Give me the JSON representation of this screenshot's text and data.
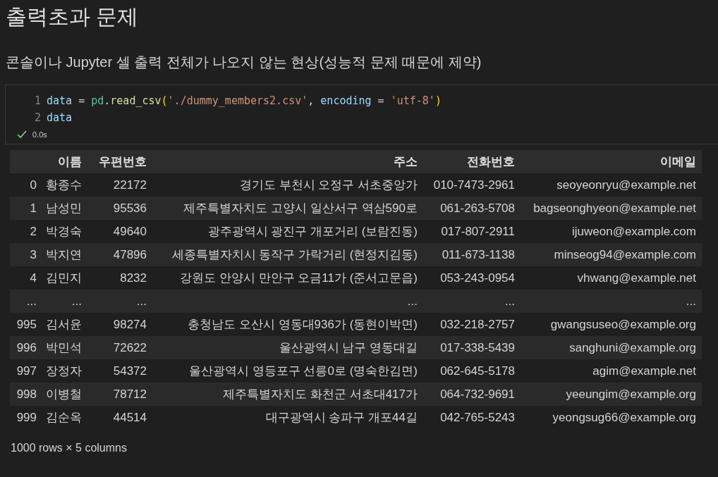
{
  "heading": "출력초과 문제",
  "description": "콘솔이나 Jupyter 셀 출력 전체가 나오지 않는 현상(성능적 문제 때문에 제약)",
  "code_cell": {
    "lines": [
      {
        "number": "1",
        "tokens": [
          {
            "kind": "variable",
            "text": "data"
          },
          {
            "kind": "plain",
            "text": " = "
          },
          {
            "kind": "module",
            "text": "pd"
          },
          {
            "kind": "plain",
            "text": "."
          },
          {
            "kind": "function",
            "text": "read_csv"
          },
          {
            "kind": "bracket",
            "text": "("
          },
          {
            "kind": "string",
            "text": "'./dummy_members2.csv'"
          },
          {
            "kind": "plain",
            "text": ", "
          },
          {
            "kind": "variable",
            "text": "encoding"
          },
          {
            "kind": "plain",
            "text": " = "
          },
          {
            "kind": "string",
            "text": "'utf-8'"
          },
          {
            "kind": "bracket",
            "text": ")"
          }
        ]
      },
      {
        "number": "2",
        "tokens": [
          {
            "kind": "variable",
            "text": "data"
          }
        ]
      }
    ],
    "succeeded": true,
    "duration": "0.0s"
  },
  "table": {
    "columns": [
      "",
      "이름",
      "우편번호",
      "주소",
      "전화번호",
      "이메일"
    ],
    "rows": [
      [
        "0",
        "황종수",
        "22172",
        "경기도 부천시 오정구 서초중앙가",
        "010-7473-2961",
        "seoyeonryu@example.net"
      ],
      [
        "1",
        "남성민",
        "95536",
        "제주특별자치도 고양시 일산서구 역삼590로",
        "061-263-5708",
        "bagseonghyeon@example.net"
      ],
      [
        "2",
        "박경숙",
        "49640",
        "광주광역시 광진구 개포거리 (보람진동)",
        "017-807-2911",
        "ijuweon@example.com"
      ],
      [
        "3",
        "박지연",
        "47896",
        "세종특별자치시 동작구 가락거리 (현정지김동)",
        "011-673-1138",
        "minseog94@example.com"
      ],
      [
        "4",
        "김민지",
        "8232",
        "강원도 안양시 만안구 오금11가 (준서고문읍)",
        "053-243-0954",
        "vhwang@example.net"
      ],
      [
        "...",
        "...",
        "...",
        "...",
        "...",
        "..."
      ],
      [
        "995",
        "김서윤",
        "98274",
        "충청남도 오산시 영동대936가 (동현이박면)",
        "032-218-2757",
        "gwangsuseo@example.org"
      ],
      [
        "996",
        "박민석",
        "72622",
        "울산광역시 남구 영동대길",
        "017-338-5439",
        "sanghuni@example.org"
      ],
      [
        "997",
        "장정자",
        "54372",
        "울산광역시 영등포구 선릉0로 (명숙한김면)",
        "062-645-5178",
        "agim@example.net"
      ],
      [
        "998",
        "이병철",
        "78712",
        "제주특별자치도 화천군 서초대417가",
        "064-732-9691",
        "yeeungim@example.org"
      ],
      [
        "999",
        "김순옥",
        "44514",
        "대구광역시 송파구 개포44길",
        "042-765-5243",
        "yeongsug66@example.org"
      ]
    ]
  },
  "summary": "1000 rows × 5 columns"
}
